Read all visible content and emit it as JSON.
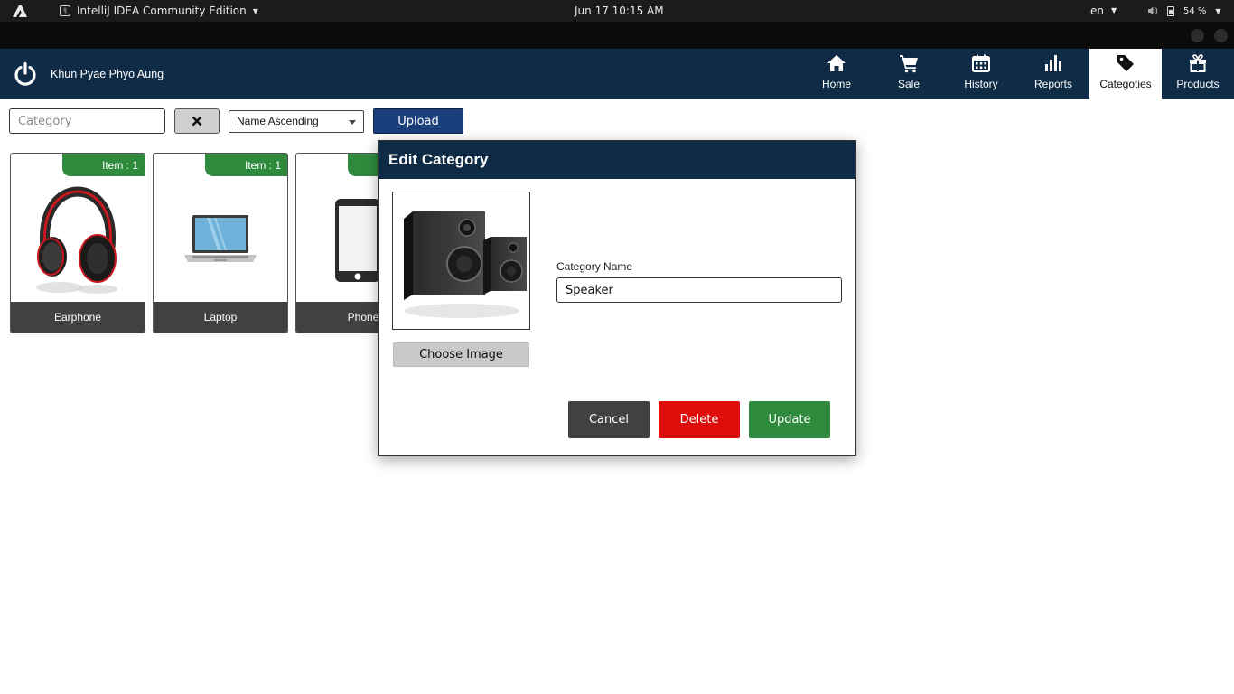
{
  "os_bar": {
    "app_name": "IntelliJ IDEA Community Edition",
    "app_icon_text": "IJ",
    "clock": "Jun 17  10:15 AM",
    "language": "en",
    "battery": "54 %"
  },
  "header": {
    "user_name": "Khun Pyae Phyo Aung",
    "nav": [
      {
        "label": "Home",
        "icon": "home-icon"
      },
      {
        "label": "Sale",
        "icon": "cart-icon"
      },
      {
        "label": "History",
        "icon": "calendar-icon"
      },
      {
        "label": "Reports",
        "icon": "bar-chart-icon"
      },
      {
        "label": "Categoties",
        "icon": "tag-icon",
        "active": true
      },
      {
        "label": "Products",
        "icon": "gift-icon"
      }
    ]
  },
  "toolbar": {
    "search_placeholder": "Category",
    "sort_selected": "Name Ascending",
    "upload_label": "Upload"
  },
  "categories": [
    {
      "name": "Earphone",
      "badge": "Item : 1",
      "image": "headphones"
    },
    {
      "name": "Laptop",
      "badge": "Item : 1",
      "image": "laptop"
    },
    {
      "name": "Phone",
      "badge": "",
      "image": "phone"
    }
  ],
  "dialog": {
    "title": "Edit Category",
    "choose_image_label": "Choose Image",
    "field_label": "Category Name",
    "field_value": "Speaker",
    "cancel_label": "Cancel",
    "delete_label": "Delete",
    "update_label": "Update",
    "image": "speaker"
  },
  "colors": {
    "header_bg": "#0f2b46",
    "badge_green": "#2e8b3e",
    "delete_red": "#df0c0c",
    "upload_blue": "#1b3f7b",
    "card_label_bg": "#414141"
  }
}
